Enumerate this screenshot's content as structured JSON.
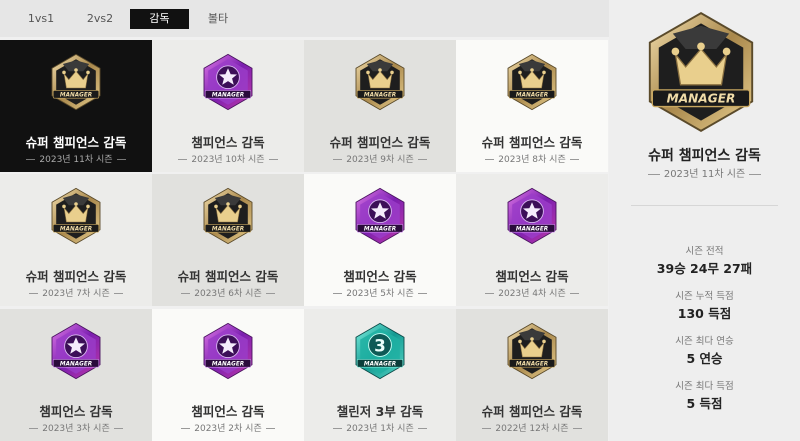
{
  "tabs": [
    {
      "label": "1vs1",
      "active": false
    },
    {
      "label": "2vs2",
      "active": false
    },
    {
      "label": "감독",
      "active": true
    },
    {
      "label": "볼타",
      "active": false
    }
  ],
  "badge_label": "MANAGER",
  "cards": [
    {
      "title": "슈퍼 챔피언스 감독",
      "season": "2023년 11차 시즌",
      "badge": "crown-icon",
      "selected": true
    },
    {
      "title": "챔피언스 감독",
      "season": "2023년 10차 시즌",
      "badge": "star-icon"
    },
    {
      "title": "슈퍼 챔피언스 감독",
      "season": "2023년 9차 시즌",
      "badge": "crown-icon"
    },
    {
      "title": "슈퍼 챔피언스 감독",
      "season": "2023년 8차 시즌",
      "badge": "crown-icon"
    },
    {
      "title": "슈퍼 챔피언스 감독",
      "season": "2023년 7차 시즌",
      "badge": "crown-icon"
    },
    {
      "title": "슈퍼 챔피언스 감독",
      "season": "2023년 6차 시즌",
      "badge": "crown-icon"
    },
    {
      "title": "챔피언스 감독",
      "season": "2023년 5차 시즌",
      "badge": "star-icon"
    },
    {
      "title": "챔피언스 감독",
      "season": "2023년 4차 시즌",
      "badge": "star-icon"
    },
    {
      "title": "챔피언스 감독",
      "season": "2023년 3차 시즌",
      "badge": "star-icon"
    },
    {
      "title": "챔피언스 감독",
      "season": "2023년 2차 시즌",
      "badge": "star-icon"
    },
    {
      "title": "챌린저 3부 감독",
      "season": "2023년 1차 시즌",
      "badge": "number-3-icon",
      "badge_number": "3"
    },
    {
      "title": "슈퍼 챔피언스 감독",
      "season": "2022년 12차 시즌",
      "badge": "crown-icon"
    }
  ],
  "detail": {
    "title": "슈퍼 챔피언스 감독",
    "season": "2023년 11차 시즌",
    "badge": "crown-icon",
    "stats": [
      {
        "label": "시즌 전적",
        "value": "39승 24무 27패"
      },
      {
        "label": "시즌 누적 득점",
        "value": "130 득점"
      },
      {
        "label": "시즌 최다 연승",
        "value": "5 연승"
      },
      {
        "label": "시즌 최다 득점",
        "value": "5 득점"
      }
    ]
  },
  "colors": {
    "crown_gold": "#d8b46a",
    "star_purple": "#8a2fc2",
    "challenger_teal": "#22b3a8",
    "selected_bg": "#111111"
  }
}
